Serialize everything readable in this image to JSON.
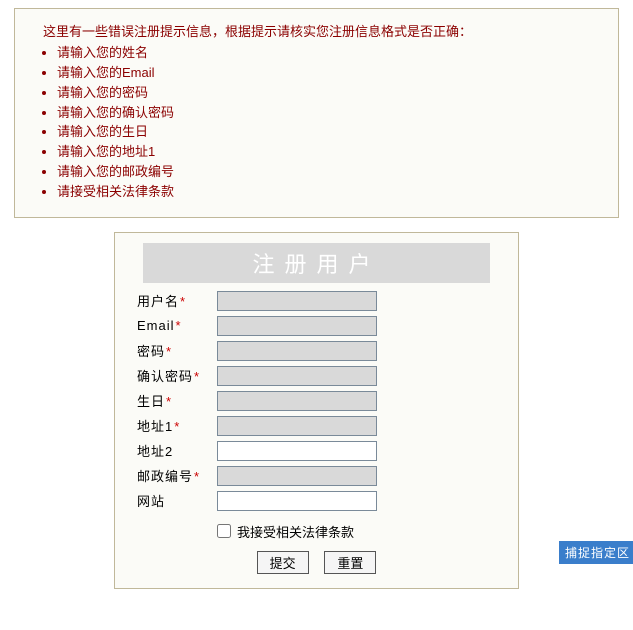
{
  "errors": {
    "intro": "这里有一些错误注册提示信息，根据提示请核实您注册信息格式是否正确：",
    "items": [
      "请输入您的姓名",
      "请输入您的Email",
      "请输入您的密码",
      "请输入您的确认密码",
      "请输入您的生日",
      "请输入您的地址1",
      "请输入您的邮政编号",
      "请接受相关法律条款"
    ]
  },
  "form": {
    "header": "注册用户",
    "fields": {
      "username": {
        "label": "用户名",
        "required": true,
        "value": "",
        "error": true
      },
      "email": {
        "label": "Email",
        "required": true,
        "value": "",
        "error": true
      },
      "password": {
        "label": "密码",
        "required": true,
        "value": "",
        "error": true
      },
      "confirm": {
        "label": "确认密码",
        "required": true,
        "value": "",
        "error": true
      },
      "birthday": {
        "label": "生日",
        "required": true,
        "value": "",
        "error": true
      },
      "address1": {
        "label": "地址1",
        "required": true,
        "value": "",
        "error": true
      },
      "address2": {
        "label": "地址2",
        "required": false,
        "value": "",
        "error": false
      },
      "postal": {
        "label": "邮政编号",
        "required": true,
        "value": "",
        "error": true
      },
      "website": {
        "label": "网站",
        "required": false,
        "value": "",
        "error": false
      }
    },
    "terms_label": "我接受相关法律条款",
    "buttons": {
      "submit": "提交",
      "reset": "重置"
    }
  },
  "capture_tag": "捕捉指定区"
}
